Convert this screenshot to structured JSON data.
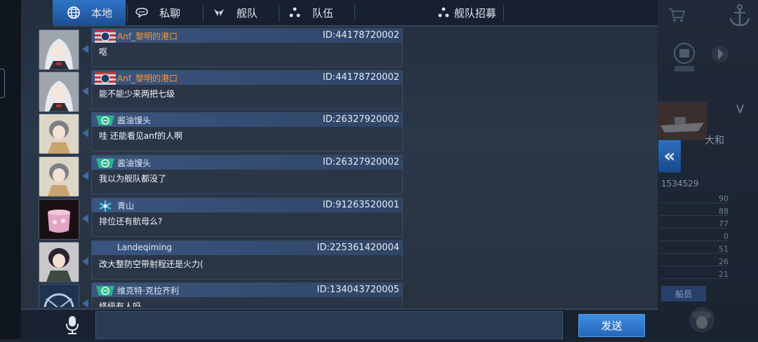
{
  "tabs": [
    {
      "label": "本地",
      "icon": "globe-icon",
      "active": true
    },
    {
      "label": "私聊",
      "icon": "chat-bubble-icon",
      "active": false
    },
    {
      "label": "舰队",
      "icon": "fleet-flag-icon",
      "active": false
    },
    {
      "label": "队伍",
      "icon": "team-dots-icon",
      "active": false
    },
    {
      "label": "舰队招募",
      "icon": "recruit-dots-icon",
      "active": false
    }
  ],
  "messages": [
    {
      "name": "Anf_黎明的港口",
      "id": "ID:44178720002",
      "text": "呕",
      "badge": "stripes-flag-badge",
      "name_color": "orange"
    },
    {
      "name": "Anf_黎明的港口",
      "id": "ID:44178720002",
      "text": "能不能少来两把七级",
      "badge": "stripes-flag-badge",
      "name_color": "orange"
    },
    {
      "name": "酱油馒头",
      "id": "ID:26327920002",
      "text": "哇  还能看见anf的人啊",
      "badge": "green-emblem-badge",
      "name_color": "default"
    },
    {
      "name": "酱油馒头",
      "id": "ID:26327920002",
      "text": "我以为舰队都没了",
      "badge": "green-emblem-badge",
      "name_color": "default"
    },
    {
      "name": "青山",
      "id": "ID:91263520001",
      "text": "排位还有航母么?",
      "badge": "snowflake-badge",
      "name_color": "default"
    },
    {
      "name": "Landeqiming",
      "id": "ID:225361420004",
      "text": "改大整防空带射程还是火力(",
      "badge": "",
      "name_color": "default"
    },
    {
      "name": "维克特·克拉齐利",
      "id": "ID:134043720005",
      "text": "终级有人吗",
      "badge": "green-emblem-badge",
      "name_color": "default"
    }
  ],
  "input": {
    "value": "",
    "placeholder": ""
  },
  "send_label": "发送",
  "side": {
    "ship_name": "大和",
    "ship_id": "1534529",
    "stats": [
      "90",
      "88",
      "77",
      "0",
      "51",
      "26",
      "21"
    ],
    "crew_label": "船员",
    "grade": "V"
  },
  "colors": {
    "accent": "#2f74c7",
    "orange_name": "#f09a3c"
  }
}
